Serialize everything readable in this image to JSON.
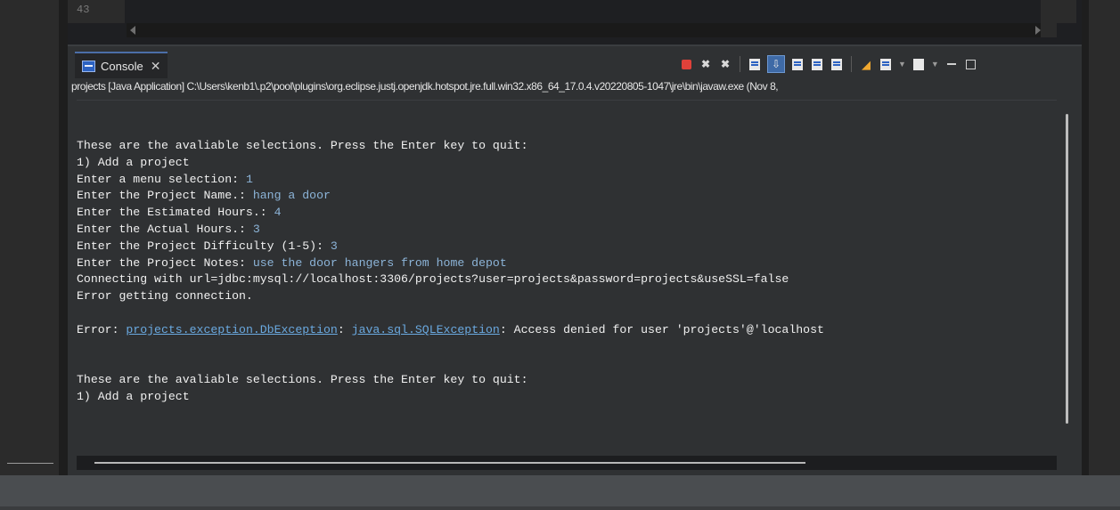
{
  "editor": {
    "visible_line_number": "43"
  },
  "console": {
    "tab_label": "Console",
    "process_info": "projects [Java Application] C:\\Users\\kenb1\\.p2\\pool\\plugins\\org.eclipse.justj.openjdk.hotspot.jre.full.win32.x86_64_17.0.4.v20220805-1047\\jre\\bin\\javaw.exe  (Nov 8,",
    "lines": [
      {
        "text": "These are the avaliable selections. Press the Enter key to quit:"
      },
      {
        "text": "1) Add a project"
      },
      {
        "prompt": "Enter a menu selection: ",
        "input": "1"
      },
      {
        "prompt": "Enter the Project Name.: ",
        "input": "hang a door"
      },
      {
        "prompt": "Enter the Estimated Hours.: ",
        "input": "4"
      },
      {
        "prompt": "Enter the Actual Hours.: ",
        "input": "3"
      },
      {
        "prompt": "Enter the Project Difficulty (1-5): ",
        "input": "3"
      },
      {
        "prompt": "Enter the Project Notes: ",
        "input": "use the door hangers from home depot"
      },
      {
        "text": "Connecting with url=jdbc:mysql://localhost:3306/projects?user=projects&password=projects&useSSL=false"
      },
      {
        "text": "Error getting connection."
      },
      {
        "text": ""
      },
      {
        "error_prefix": "Error: ",
        "link1": "projects.exception.DbException",
        "sep": ": ",
        "link2": "java.sql.SQLException",
        "rest": ": Access denied for user 'projects'@'localhost"
      },
      {
        "text": ""
      },
      {
        "text": ""
      },
      {
        "text": "These are the avaliable selections. Press the Enter key to quit:"
      },
      {
        "text": "1) Add a project"
      }
    ]
  },
  "toolbar_icons": [
    "terminate-icon",
    "remove-launch-icon",
    "remove-all-terminated-icon",
    "clear-console-icon",
    "scroll-lock-icon",
    "word-wrap-icon",
    "show-on-stdout-icon",
    "show-on-stderr-icon",
    "pin-console-icon",
    "display-selected-console-icon",
    "open-console-icon",
    "minimize-icon",
    "maximize-icon"
  ],
  "colors": {
    "user_input": "#8cb4d8",
    "link": "#6aa9e0",
    "console_bg": "#2f3133"
  }
}
